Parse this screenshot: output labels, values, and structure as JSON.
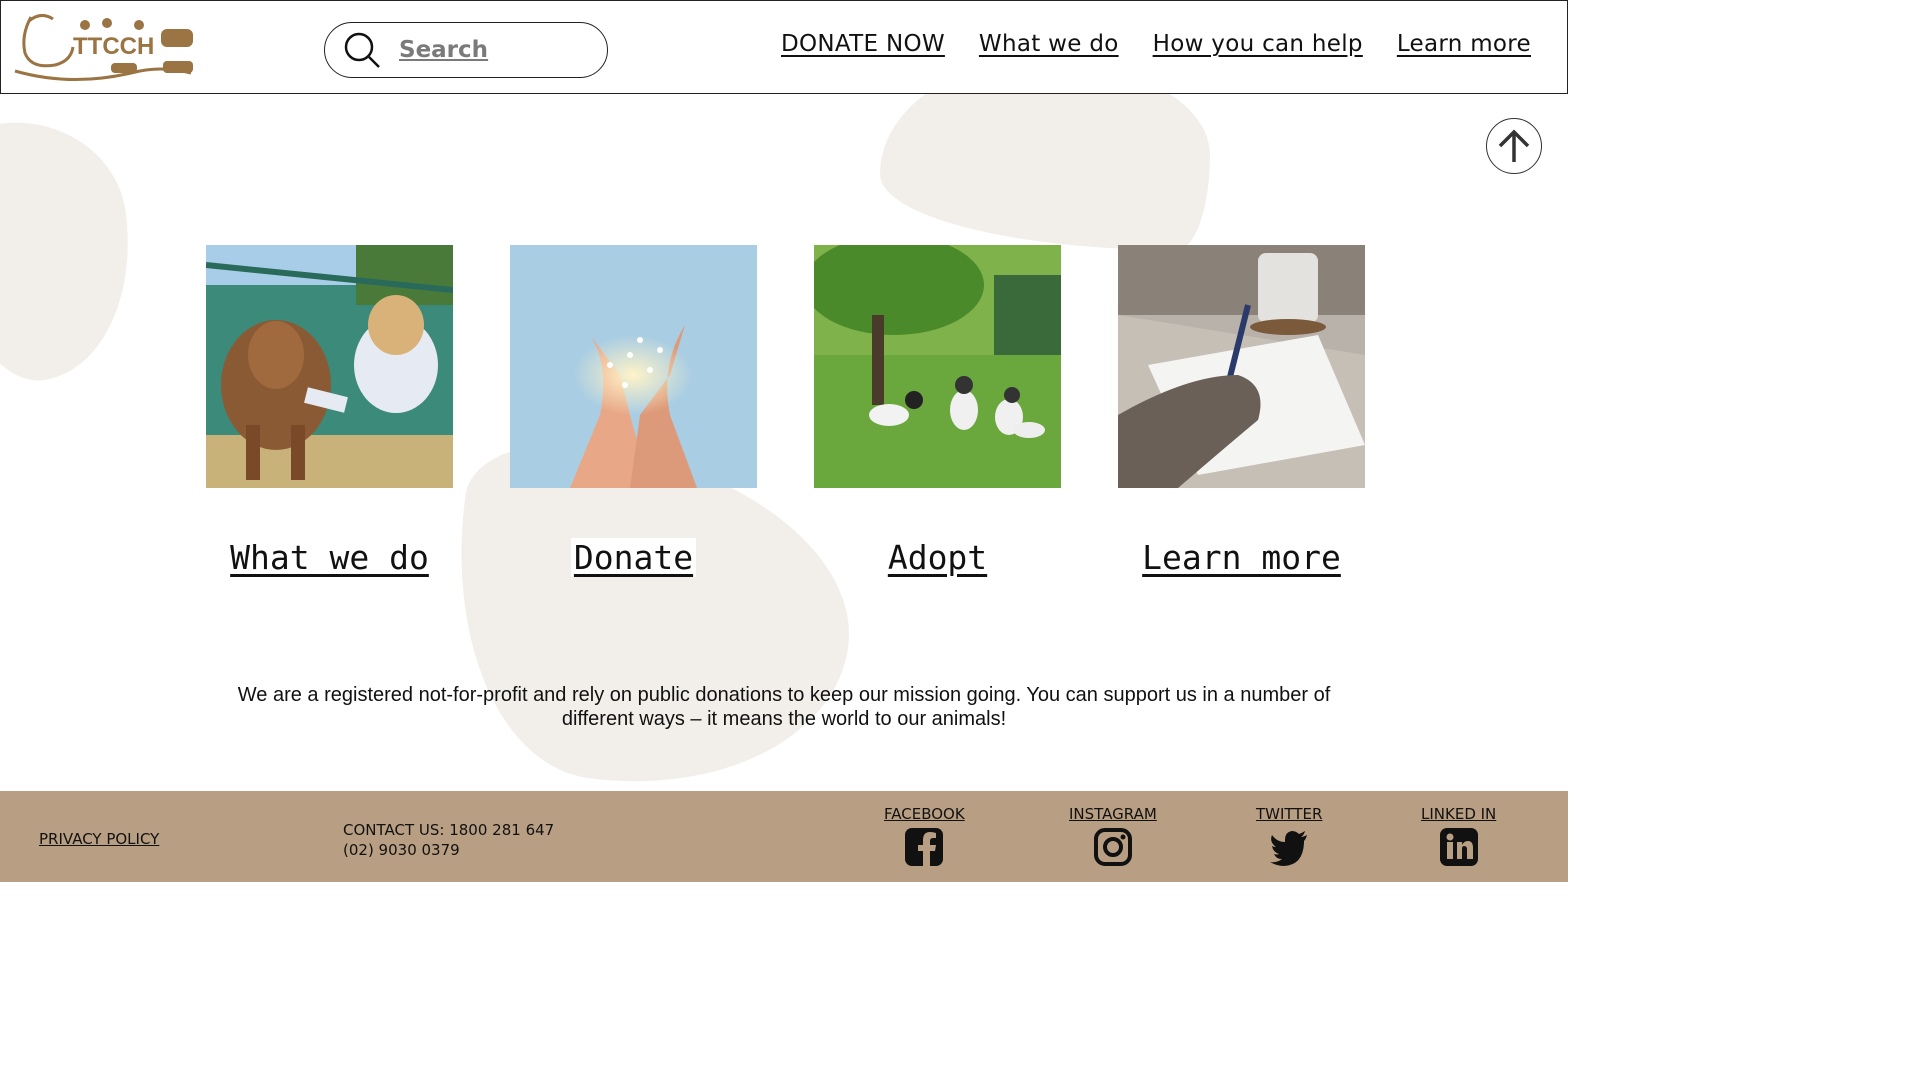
{
  "header": {
    "logo_text": "TTCCH",
    "search_placeholder": "Search",
    "nav": [
      {
        "label": "DONATE NOW"
      },
      {
        "label": "What we do"
      },
      {
        "label": "How you can help"
      },
      {
        "label": "Learn more"
      }
    ]
  },
  "back_to_top_icon": "arrow-up-icon",
  "cards": [
    {
      "label": "What we do",
      "image": "calf-and-woman-photo"
    },
    {
      "label": "Donate",
      "image": "hands-with-fairy-lights-photo"
    },
    {
      "label": "Adopt",
      "image": "goats-in-field-photo"
    },
    {
      "label": "Learn more",
      "image": "writing-notes-photo"
    }
  ],
  "mission_text": "We are a registered not-for-profit and rely on public donations to keep our mission going. You can support us in a number of different ways – it means the world to our animals!",
  "footer": {
    "privacy": "PRIVACY POLICY",
    "contact_line1": "CONTACT US: 1800 281 647",
    "contact_line2": "(02) 9030 0379",
    "social": [
      {
        "label": "FACEBOOK",
        "icon": "facebook-icon"
      },
      {
        "label": "INSTAGRAM",
        "icon": "instagram-icon"
      },
      {
        "label": "TWITTER",
        "icon": "twitter-icon"
      },
      {
        "label": "LINKED IN",
        "icon": "linkedin-icon"
      }
    ]
  },
  "colors": {
    "brand_brown": "#9a7443",
    "footer_bg": "#b89f83",
    "blob": "#f2efeb"
  }
}
